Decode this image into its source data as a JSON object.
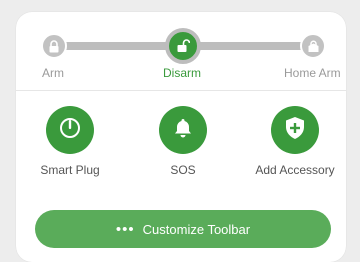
{
  "colors": {
    "accent": "#3a9a3c",
    "inactive": "#c2c2c2",
    "track": "#bdbdbd"
  },
  "modes": [
    {
      "label": "Arm",
      "icon": "lock-icon",
      "active": false
    },
    {
      "label": "Disarm",
      "icon": "unlock-icon",
      "active": true
    },
    {
      "label": "Home Arm",
      "icon": "home-lock-icon",
      "active": false
    }
  ],
  "actions": [
    {
      "label": "Smart Plug",
      "icon": "power-icon"
    },
    {
      "label": "SOS",
      "icon": "bell-icon"
    },
    {
      "label": "Add Accessory",
      "icon": "shield-plus-icon"
    }
  ],
  "toolbar": {
    "label": "Customize Toolbar",
    "icon": "more-dots-icon",
    "dots": "•••"
  }
}
